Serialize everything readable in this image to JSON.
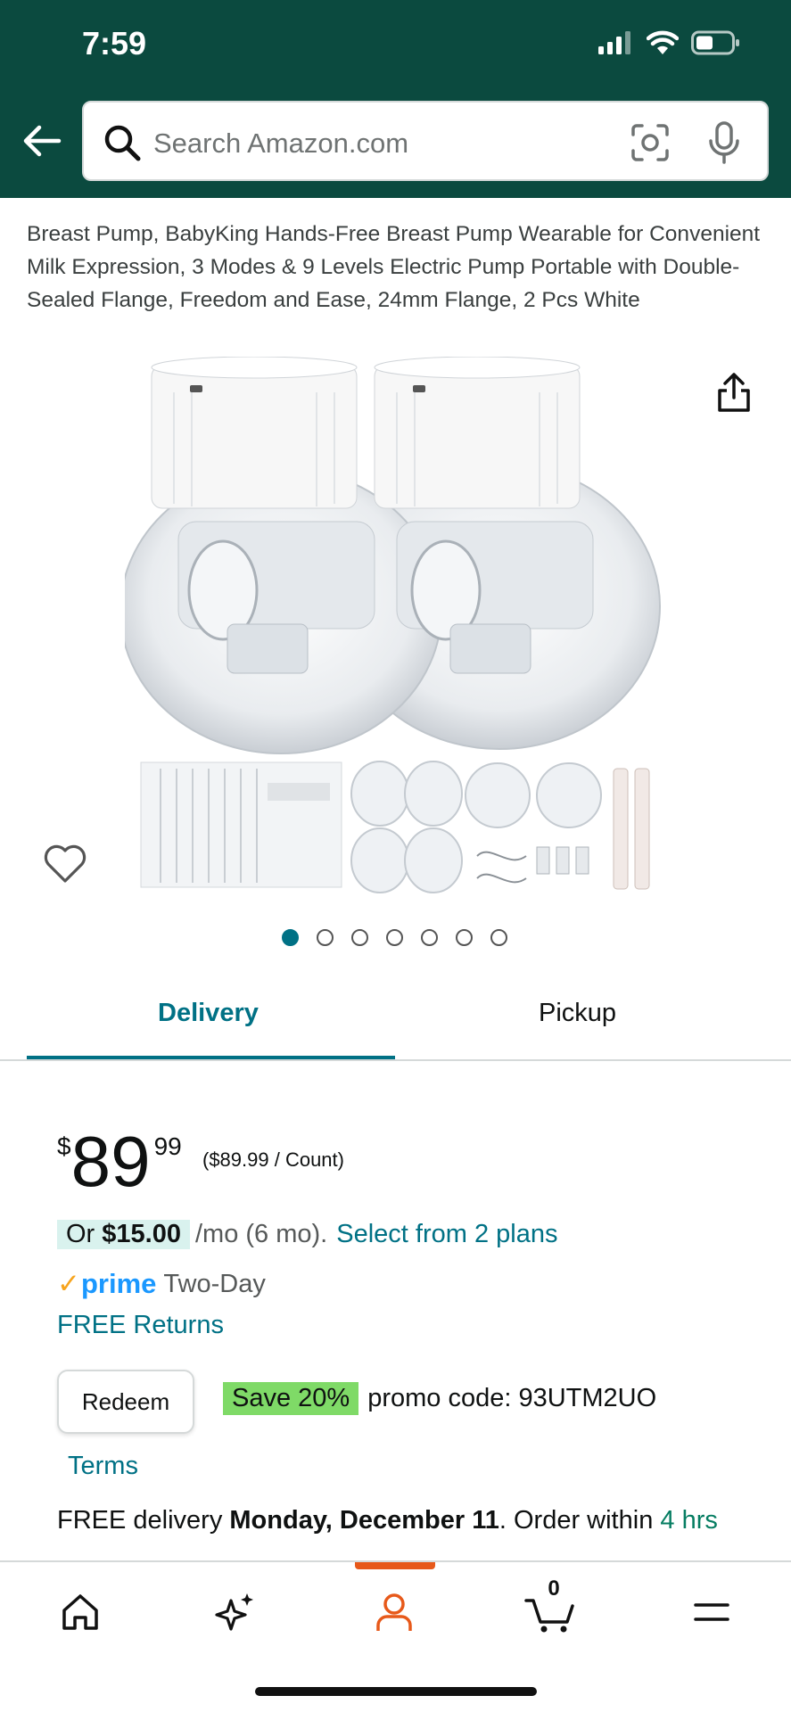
{
  "status_bar": {
    "time": "7:59"
  },
  "search": {
    "placeholder": "Search Amazon.com"
  },
  "product": {
    "title": "Breast Pump, BabyKing Hands-Free Breast Pump Wearable for Convenient Milk Expression, 3 Modes & 9 Levels Electric Pump Portable with Double-Sealed Flange, Freedom and Ease, 24mm Flange, 2 Pcs White",
    "image_count": 7,
    "active_image_index": 0
  },
  "tabs": [
    {
      "label": "Delivery",
      "active": true
    },
    {
      "label": "Pickup",
      "active": false
    }
  ],
  "price": {
    "symbol": "$",
    "whole": "89",
    "fraction": "99",
    "unit": "($89.99 / Count)"
  },
  "installment": {
    "prefix": "Or",
    "amount": "$15.00",
    "term": "/mo (6 mo).",
    "link": "Select from 2 plans"
  },
  "prime": {
    "logo": "prime",
    "shipping": "Two-Day"
  },
  "returns": "FREE Returns",
  "coupon": {
    "button": "Redeem",
    "badge": "Save 20%",
    "text": "promo code: 93UTM2UO",
    "terms": "Terms"
  },
  "delivery": {
    "prefix": "FREE delivery",
    "date": "Monday, December 11",
    "order_within": ". Order within",
    "countdown": "4 hrs"
  },
  "bottom_nav": {
    "items": [
      "home-icon",
      "sparkle-icon",
      "account-icon",
      "cart-icon",
      "menu-icon"
    ],
    "cart_count": "0",
    "active": "account-icon"
  },
  "colors": {
    "header_bg": "#0b4a3f",
    "link": "#007185",
    "accent": "#e7591a",
    "save_badge": "#7fda67",
    "installment_bg": "#d9f2ee",
    "prime_blue": "#1a98ff"
  }
}
